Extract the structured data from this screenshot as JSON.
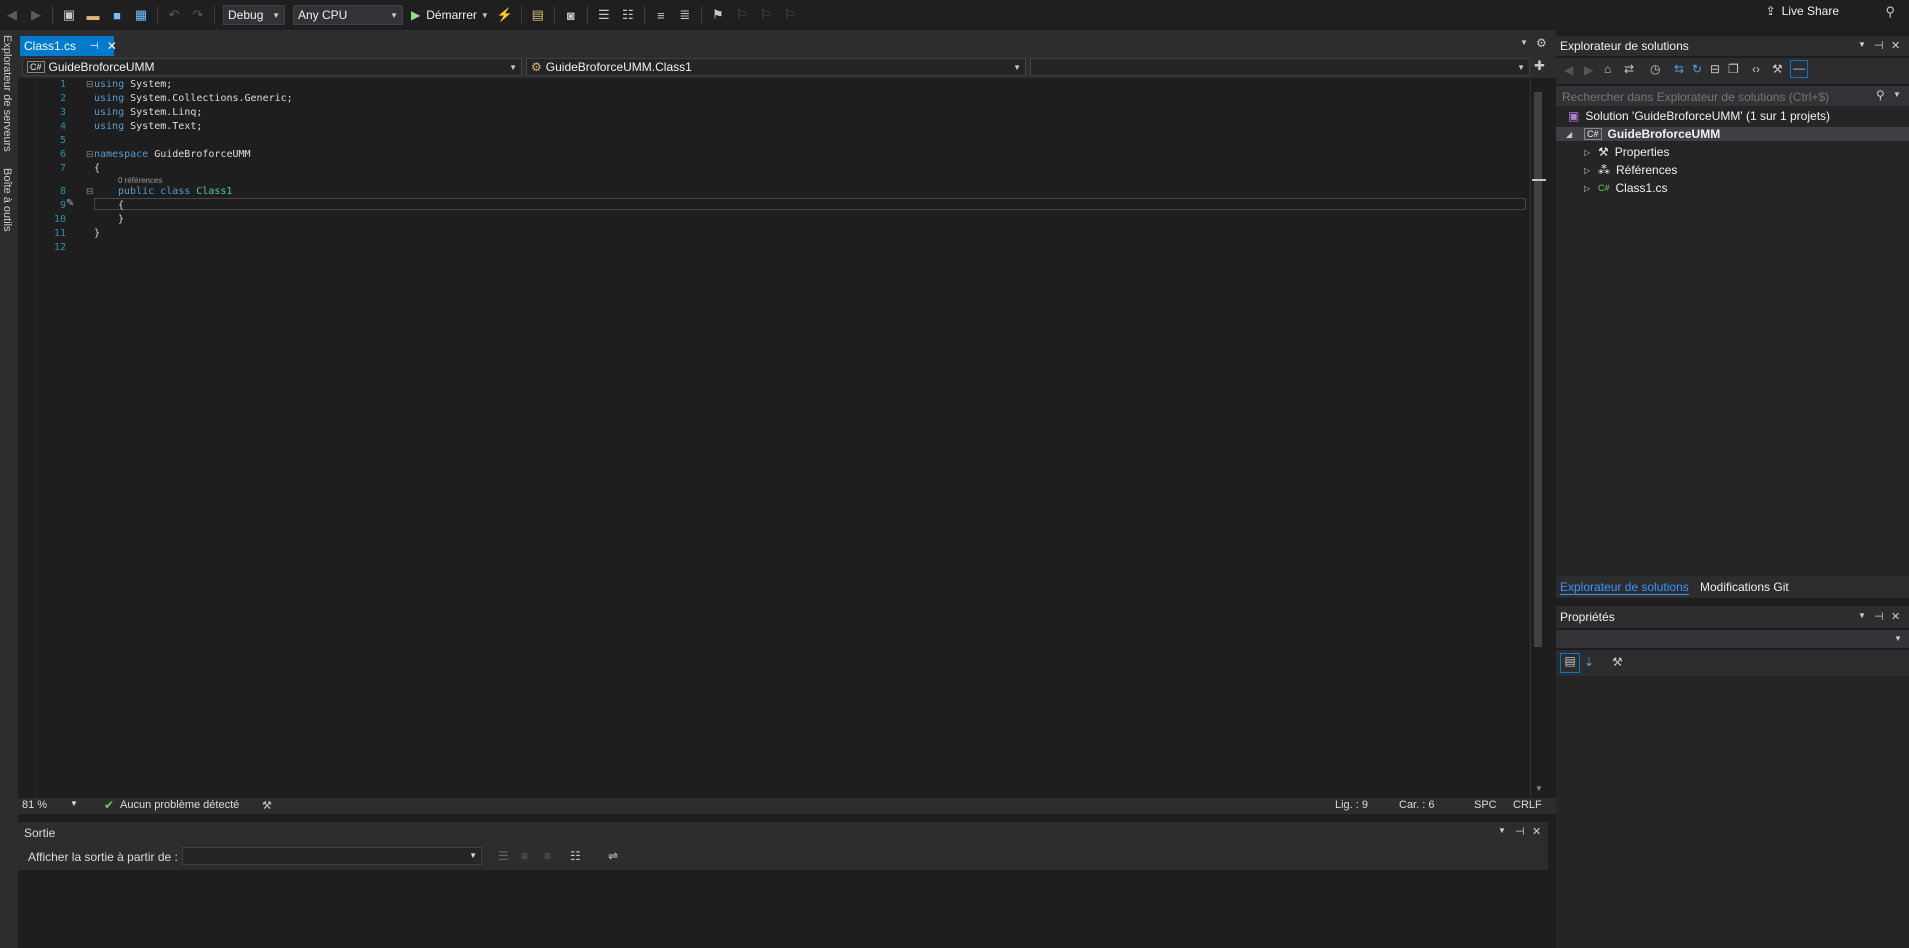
{
  "toolbar": {
    "config": "Debug",
    "platform": "Any CPU",
    "start_label": "Démarrer",
    "live_share": "Live Share"
  },
  "left_strip": {
    "server_explorer": "Explorateur de serveurs",
    "toolbox": "Boîte à outils"
  },
  "editor": {
    "tab_label": "Class1.cs",
    "nav_project": "GuideBroforceUMM",
    "nav_class": "GuideBroforceUMM.Class1",
    "nav_member": "",
    "line_numbers": [
      "1",
      "2",
      "3",
      "4",
      "5",
      "6",
      "7",
      "8",
      "9",
      "10",
      "11",
      "12"
    ],
    "code": {
      "l1_kw": "using",
      "l1_rest": " System;",
      "l2_kw": "using",
      "l2_rest": " System.Collections.Generic;",
      "l3_kw": "using",
      "l3_rest": " System.Linq;",
      "l4_kw": "using",
      "l4_rest": " System.Text;",
      "l6_kw": "namespace",
      "l6_rest": " GuideBroforceUMM",
      "l7": "{",
      "refs": "0 références",
      "l8_kw": "public class",
      "l8_type": "Class1",
      "l9": "{",
      "l10": "}",
      "l11": "}"
    },
    "status": {
      "zoom": "81 %",
      "issues": "Aucun problème détecté",
      "line": "Lig. : 9",
      "col": "Car. : 6",
      "spc": "SPC",
      "crlf": "CRLF"
    }
  },
  "output": {
    "title": "Sortie",
    "show_from_label": "Afficher la sortie à partir de :",
    "source_value": ""
  },
  "solution_explorer": {
    "title": "Explorateur de solutions",
    "search_placeholder": "Rechercher dans Explorateur de solutions (Ctrl+$)",
    "solution": "Solution 'GuideBroforceUMM' (1 sur 1 projets)",
    "project": "GuideBroforceUMM",
    "items": [
      "Properties",
      "Références",
      "Class1.cs"
    ],
    "tabs": [
      "Explorateur de solutions",
      "Modifications Git"
    ]
  },
  "properties": {
    "title": "Propriétés"
  },
  "colors": {
    "accent": "#007acc",
    "bg": "#1e1e1e",
    "keyword": "#569cd6",
    "type": "#4ec9b0"
  }
}
